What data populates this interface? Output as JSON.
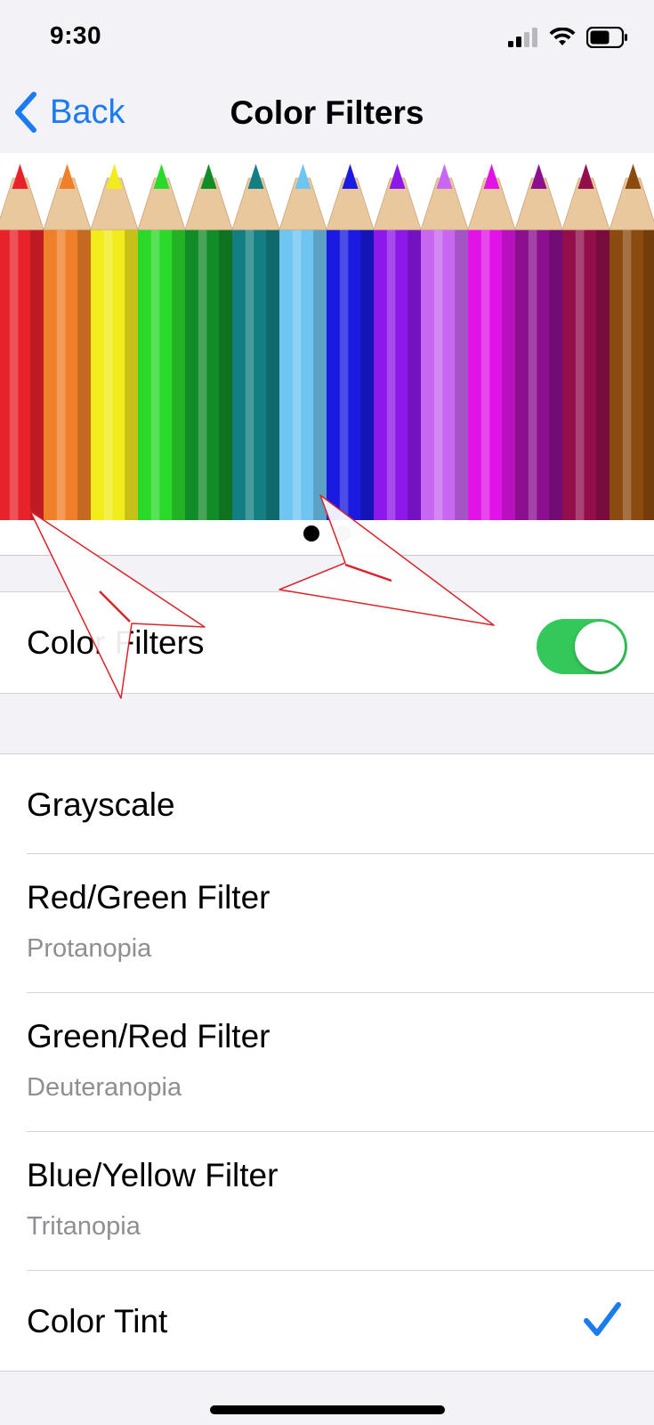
{
  "status_bar": {
    "time": "9:30",
    "signal_icon": "cellular-signal-icon",
    "wifi_icon": "wifi-icon",
    "battery_icon": "battery-icon"
  },
  "nav": {
    "back_label": "Back",
    "back_icon": "chevron-left-icon",
    "title": "Color Filters"
  },
  "hero": {
    "pencil_colors": [
      "#e8222a",
      "#f07f2a",
      "#f3ec1d",
      "#2bd92b",
      "#128c28",
      "#137f82",
      "#6ec5f1",
      "#1a1ae0",
      "#8d18ea",
      "#c867f1",
      "#e014e6",
      "#8b0f8f",
      "#930f4c",
      "#8b4a0e"
    ],
    "page_count": 2,
    "active_page": 1
  },
  "color_filters_toggle": {
    "label": "Color Filters",
    "on": true,
    "on_color": "#34c759"
  },
  "filters": [
    {
      "label": "Grayscale",
      "subtitle": "",
      "selected": false
    },
    {
      "label": "Red/Green Filter",
      "subtitle": "Protanopia",
      "selected": false
    },
    {
      "label": "Green/Red Filter",
      "subtitle": "Deuteranopia",
      "selected": false
    },
    {
      "label": "Blue/Yellow Filter",
      "subtitle": "Tritanopia",
      "selected": false
    },
    {
      "label": "Color Tint",
      "subtitle": "",
      "selected": true
    }
  ],
  "colors": {
    "accent": "#1a7cf0",
    "background": "#f2f2f7",
    "annotation": "#d8242a"
  }
}
